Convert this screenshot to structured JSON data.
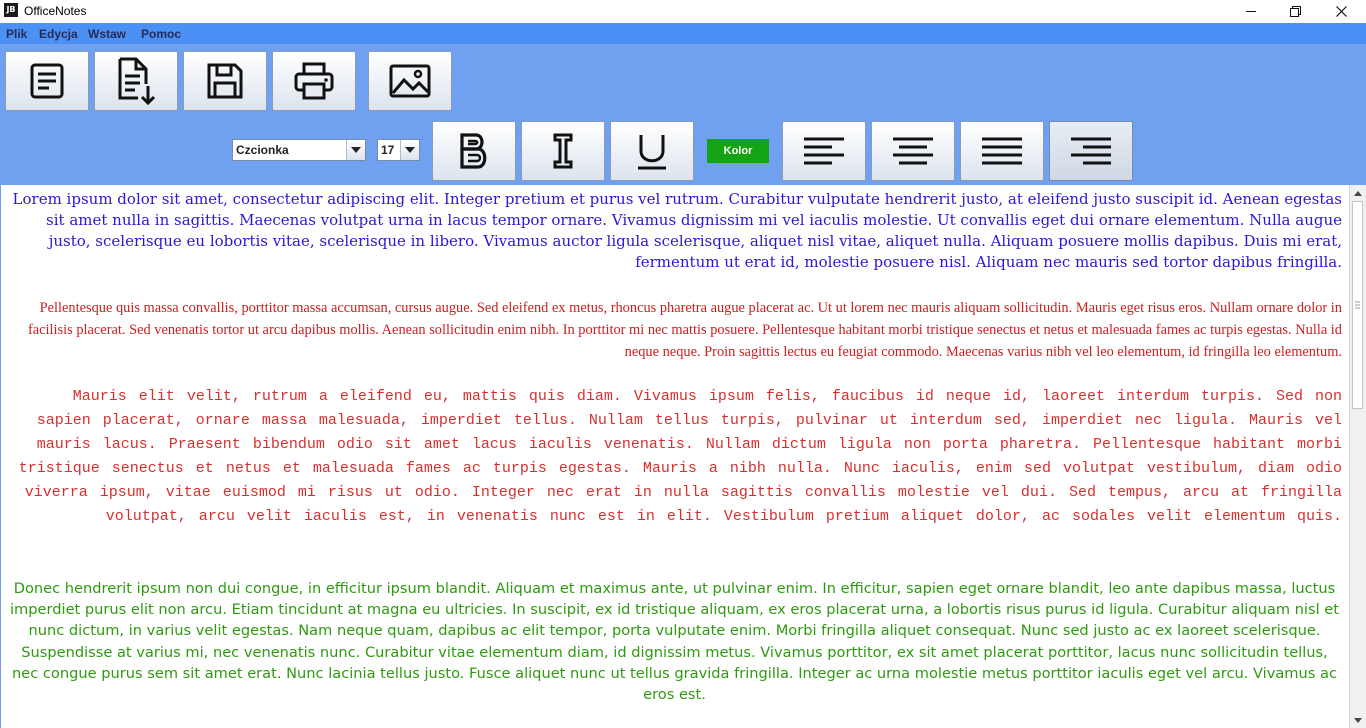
{
  "window": {
    "app_icon_text": "JB",
    "title": "OfficeNotes"
  },
  "menu": [
    "Plik",
    "Edycja",
    "Wstaw",
    "Pomoc"
  ],
  "toolbar": {
    "icons": [
      "new-document",
      "export-document",
      "save",
      "print",
      "insert-image"
    ],
    "font_combo": "Czcionka",
    "size_combo": "17",
    "color_button": "Kolor",
    "format_icons": [
      "bold",
      "italic",
      "underline"
    ],
    "align_icons": [
      "align-left",
      "align-center",
      "align-justify",
      "align-right"
    ],
    "active_alignment": "align-right"
  },
  "colors": {
    "menubar": "#4a90f5",
    "toolbar": "#6fa1f0",
    "color_button": "#13a313"
  },
  "document": {
    "paragraphs": [
      {
        "color": "#2b17d6",
        "text": "Lorem ipsum dolor sit amet, consectetur adipiscing elit. Integer pretium et purus vel rutrum. Curabitur vulputate hendrerit justo, at eleifend justo suscipit id. Aenean egestas sit amet nulla in sagittis. Maecenas volutpat urna in lacus tempor ornare. Vivamus dignissim mi vel iaculis molestie. Ut convallis eget dui ornare elementum. Nulla augue justo, scelerisque eu lobortis vitae, scelerisque in libero. Vivamus auctor ligula scelerisque, aliquet nisl vitae, aliquet nulla. Aliquam posuere mollis dapibus. Duis mi erat, fermentum ut erat id, molestie posuere nisl. Aliquam nec mauris sed tortor dapibus fringilla."
      },
      {
        "color": "#cc1f1f",
        "text": "Pellentesque quis massa convallis, porttitor massa accumsan, cursus augue. Sed eleifend ex metus, rhoncus pharetra augue placerat ac. Ut ut lorem nec mauris aliquam sollicitudin. Mauris eget risus eros. Nullam ornare dolor in facilisis placerat. Sed venenatis tortor ut arcu dapibus mollis. Aenean sollicitudin enim nibh. In porttitor mi nec mattis posuere. Pellentesque habitant morbi tristique senectus et netus et malesuada fames ac turpis egestas. Nulla id neque neque. Proin sagittis lectus eu feugiat commodo. Maecenas varius nibh vel leo elementum, id fringilla leo elementum."
      },
      {
        "color": "#d6302e",
        "text": "Mauris elit velit, rutrum a eleifend eu, mattis quis diam. Vivamus ipsum felis, faucibus id neque id, laoreet interdum turpis. Sed non sapien placerat, ornare massa malesuada, imperdiet tellus. Nullam tellus turpis, pulvinar ut interdum sed, imperdiet nec ligula. Mauris vel mauris lacus. Praesent bibendum odio sit amet lacus iaculis venenatis. Nullam dictum ligula non porta pharetra. Pellentesque habitant morbi tristique senectus et netus et malesuada fames ac turpis egestas. Mauris a nibh nulla. Nunc iaculis, enim sed volutpat vestibulum, diam odio viverra ipsum, vitae euismod mi risus ut odio. Integer nec erat in nulla sagittis convallis molestie vel dui. Sed tempus, arcu at fringilla volutpat, arcu velit iaculis est, in venenatis nunc est in elit. Vestibulum pretium aliquet dolor, ac sodales velit elementum quis."
      },
      {
        "color": "#2f9a10",
        "text": "Donec hendrerit ipsum non dui congue, in efficitur ipsum blandit. Aliquam et maximus ante, ut pulvinar enim. In efficitur, sapien eget ornare blandit, leo ante dapibus massa, luctus imperdiet purus elit non arcu. Etiam tincidunt at magna eu ultricies. In suscipit, ex id tristique aliquam, ex eros placerat urna, a lobortis risus purus id ligula. Curabitur aliquam nisl et nunc dictum, in varius velit egestas. Nam neque quam, dapibus ac elit tempor, porta vulputate enim. Morbi fringilla aliquet consequat. Nunc sed justo ac ex laoreet scelerisque. Suspendisse at varius mi, nec venenatis nunc. Curabitur vitae elementum diam, id dignissim metus. Vivamus porttitor, ex sit amet placerat porttitor, lacus nunc sollicitudin tellus, nec congue purus sem sit amet erat. Nunc lacinia tellus justo. Fusce aliquet nunc ut tellus gravida fringilla. Integer ac urna molestie metus porttitor iaculis eget vel arcu. Vivamus ac eros est."
      }
    ]
  }
}
